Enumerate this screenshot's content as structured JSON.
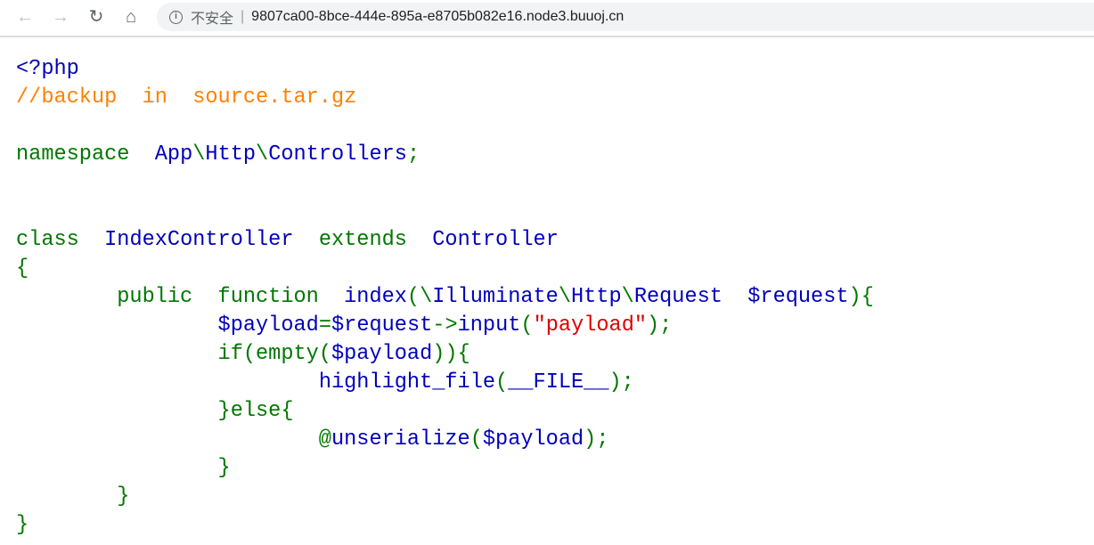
{
  "browser": {
    "nav_icons": [
      "back-arrow-icon",
      "forward-arrow-icon",
      "reload-icon",
      "home-icon",
      "info-icon"
    ],
    "security_label": "不安全",
    "url": "9807ca00-8bce-444e-895a-e8705b082e16.node3.buuoj.cn"
  },
  "colors": {
    "default": "#0000BB",
    "keyword": "#007700",
    "string": "#DD0000",
    "comment": "#FF8000"
  },
  "code_lines": [
    [
      [
        "<?php",
        "default"
      ]
    ],
    [
      [
        "//backup  in  source.tar.gz",
        "comment"
      ]
    ],
    [],
    [
      [
        "namespace  ",
        "keyword"
      ],
      [
        "App",
        "default"
      ],
      [
        "\\",
        "keyword"
      ],
      [
        "Http",
        "default"
      ],
      [
        "\\",
        "keyword"
      ],
      [
        "Controllers",
        "default"
      ],
      [
        ";",
        "keyword"
      ]
    ],
    [],
    [],
    [
      [
        "class  ",
        "keyword"
      ],
      [
        "IndexController  ",
        "default"
      ],
      [
        "extends  ",
        "keyword"
      ],
      [
        "Controller",
        "default"
      ]
    ],
    [
      [
        "{",
        "keyword"
      ]
    ],
    [
      [
        "        public  function  ",
        "keyword"
      ],
      [
        "index",
        "default"
      ],
      [
        "(\\",
        "keyword"
      ],
      [
        "Illuminate",
        "default"
      ],
      [
        "\\",
        "keyword"
      ],
      [
        "Http",
        "default"
      ],
      [
        "\\",
        "keyword"
      ],
      [
        "Request  $request",
        "default"
      ],
      [
        "){",
        "keyword"
      ]
    ],
    [
      [
        "                ",
        "keyword"
      ],
      [
        "$payload",
        "default"
      ],
      [
        "=",
        "keyword"
      ],
      [
        "$request",
        "default"
      ],
      [
        "->",
        "keyword"
      ],
      [
        "input",
        "default"
      ],
      [
        "(",
        "keyword"
      ],
      [
        "\"payload\"",
        "string"
      ],
      [
        ");",
        "keyword"
      ]
    ],
    [
      [
        "                if(",
        "keyword"
      ],
      [
        "empty",
        "keyword"
      ],
      [
        "(",
        "keyword"
      ],
      [
        "$payload",
        "default"
      ],
      [
        ")){",
        "keyword"
      ]
    ],
    [
      [
        "                        ",
        "keyword"
      ],
      [
        "highlight_file",
        "default"
      ],
      [
        "(",
        "keyword"
      ],
      [
        "__FILE__",
        "default"
      ],
      [
        ");",
        "keyword"
      ]
    ],
    [
      [
        "                }else{",
        "keyword"
      ]
    ],
    [
      [
        "                        @",
        "keyword"
      ],
      [
        "unserialize",
        "default"
      ],
      [
        "(",
        "keyword"
      ],
      [
        "$payload",
        "default"
      ],
      [
        ");",
        "keyword"
      ]
    ],
    [
      [
        "                }",
        "keyword"
      ]
    ],
    [
      [
        "        }",
        "keyword"
      ]
    ],
    [
      [
        "}",
        "keyword"
      ]
    ]
  ]
}
